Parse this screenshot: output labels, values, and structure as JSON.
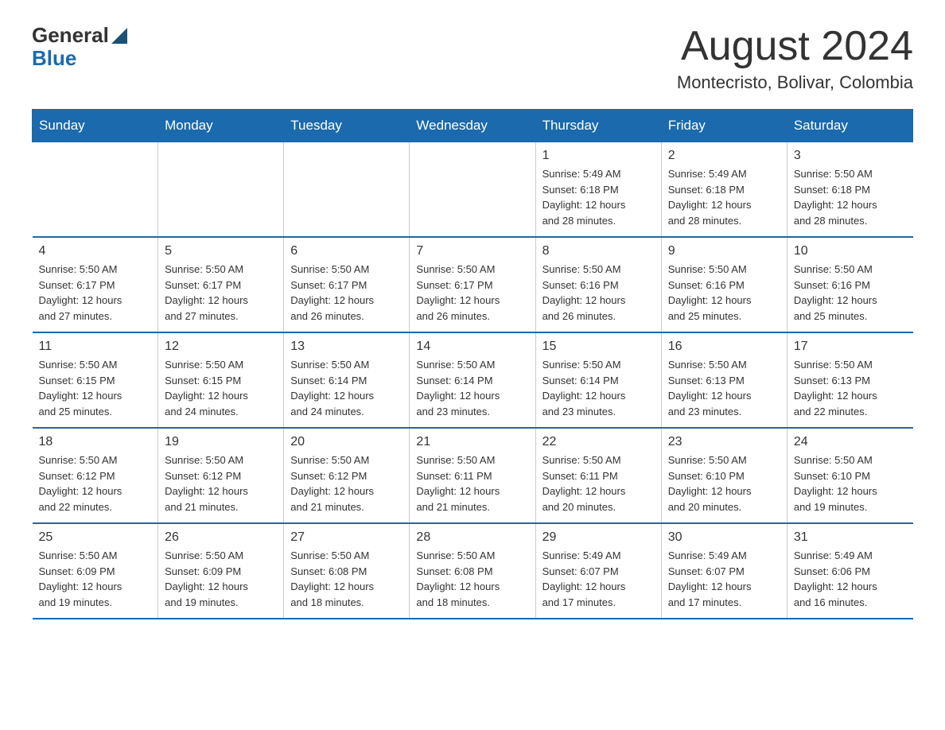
{
  "header": {
    "logo_general": "General",
    "logo_blue": "Blue",
    "month_title": "August 2024",
    "location": "Montecristo, Bolivar, Colombia"
  },
  "days_of_week": [
    "Sunday",
    "Monday",
    "Tuesday",
    "Wednesday",
    "Thursday",
    "Friday",
    "Saturday"
  ],
  "weeks": [
    [
      {
        "day": "",
        "info": ""
      },
      {
        "day": "",
        "info": ""
      },
      {
        "day": "",
        "info": ""
      },
      {
        "day": "",
        "info": ""
      },
      {
        "day": "1",
        "info": "Sunrise: 5:49 AM\nSunset: 6:18 PM\nDaylight: 12 hours\nand 28 minutes."
      },
      {
        "day": "2",
        "info": "Sunrise: 5:49 AM\nSunset: 6:18 PM\nDaylight: 12 hours\nand 28 minutes."
      },
      {
        "day": "3",
        "info": "Sunrise: 5:50 AM\nSunset: 6:18 PM\nDaylight: 12 hours\nand 28 minutes."
      }
    ],
    [
      {
        "day": "4",
        "info": "Sunrise: 5:50 AM\nSunset: 6:17 PM\nDaylight: 12 hours\nand 27 minutes."
      },
      {
        "day": "5",
        "info": "Sunrise: 5:50 AM\nSunset: 6:17 PM\nDaylight: 12 hours\nand 27 minutes."
      },
      {
        "day": "6",
        "info": "Sunrise: 5:50 AM\nSunset: 6:17 PM\nDaylight: 12 hours\nand 26 minutes."
      },
      {
        "day": "7",
        "info": "Sunrise: 5:50 AM\nSunset: 6:17 PM\nDaylight: 12 hours\nand 26 minutes."
      },
      {
        "day": "8",
        "info": "Sunrise: 5:50 AM\nSunset: 6:16 PM\nDaylight: 12 hours\nand 26 minutes."
      },
      {
        "day": "9",
        "info": "Sunrise: 5:50 AM\nSunset: 6:16 PM\nDaylight: 12 hours\nand 25 minutes."
      },
      {
        "day": "10",
        "info": "Sunrise: 5:50 AM\nSunset: 6:16 PM\nDaylight: 12 hours\nand 25 minutes."
      }
    ],
    [
      {
        "day": "11",
        "info": "Sunrise: 5:50 AM\nSunset: 6:15 PM\nDaylight: 12 hours\nand 25 minutes."
      },
      {
        "day": "12",
        "info": "Sunrise: 5:50 AM\nSunset: 6:15 PM\nDaylight: 12 hours\nand 24 minutes."
      },
      {
        "day": "13",
        "info": "Sunrise: 5:50 AM\nSunset: 6:14 PM\nDaylight: 12 hours\nand 24 minutes."
      },
      {
        "day": "14",
        "info": "Sunrise: 5:50 AM\nSunset: 6:14 PM\nDaylight: 12 hours\nand 23 minutes."
      },
      {
        "day": "15",
        "info": "Sunrise: 5:50 AM\nSunset: 6:14 PM\nDaylight: 12 hours\nand 23 minutes."
      },
      {
        "day": "16",
        "info": "Sunrise: 5:50 AM\nSunset: 6:13 PM\nDaylight: 12 hours\nand 23 minutes."
      },
      {
        "day": "17",
        "info": "Sunrise: 5:50 AM\nSunset: 6:13 PM\nDaylight: 12 hours\nand 22 minutes."
      }
    ],
    [
      {
        "day": "18",
        "info": "Sunrise: 5:50 AM\nSunset: 6:12 PM\nDaylight: 12 hours\nand 22 minutes."
      },
      {
        "day": "19",
        "info": "Sunrise: 5:50 AM\nSunset: 6:12 PM\nDaylight: 12 hours\nand 21 minutes."
      },
      {
        "day": "20",
        "info": "Sunrise: 5:50 AM\nSunset: 6:12 PM\nDaylight: 12 hours\nand 21 minutes."
      },
      {
        "day": "21",
        "info": "Sunrise: 5:50 AM\nSunset: 6:11 PM\nDaylight: 12 hours\nand 21 minutes."
      },
      {
        "day": "22",
        "info": "Sunrise: 5:50 AM\nSunset: 6:11 PM\nDaylight: 12 hours\nand 20 minutes."
      },
      {
        "day": "23",
        "info": "Sunrise: 5:50 AM\nSunset: 6:10 PM\nDaylight: 12 hours\nand 20 minutes."
      },
      {
        "day": "24",
        "info": "Sunrise: 5:50 AM\nSunset: 6:10 PM\nDaylight: 12 hours\nand 19 minutes."
      }
    ],
    [
      {
        "day": "25",
        "info": "Sunrise: 5:50 AM\nSunset: 6:09 PM\nDaylight: 12 hours\nand 19 minutes."
      },
      {
        "day": "26",
        "info": "Sunrise: 5:50 AM\nSunset: 6:09 PM\nDaylight: 12 hours\nand 19 minutes."
      },
      {
        "day": "27",
        "info": "Sunrise: 5:50 AM\nSunset: 6:08 PM\nDaylight: 12 hours\nand 18 minutes."
      },
      {
        "day": "28",
        "info": "Sunrise: 5:50 AM\nSunset: 6:08 PM\nDaylight: 12 hours\nand 18 minutes."
      },
      {
        "day": "29",
        "info": "Sunrise: 5:49 AM\nSunset: 6:07 PM\nDaylight: 12 hours\nand 17 minutes."
      },
      {
        "day": "30",
        "info": "Sunrise: 5:49 AM\nSunset: 6:07 PM\nDaylight: 12 hours\nand 17 minutes."
      },
      {
        "day": "31",
        "info": "Sunrise: 5:49 AM\nSunset: 6:06 PM\nDaylight: 12 hours\nand 16 minutes."
      }
    ]
  ]
}
